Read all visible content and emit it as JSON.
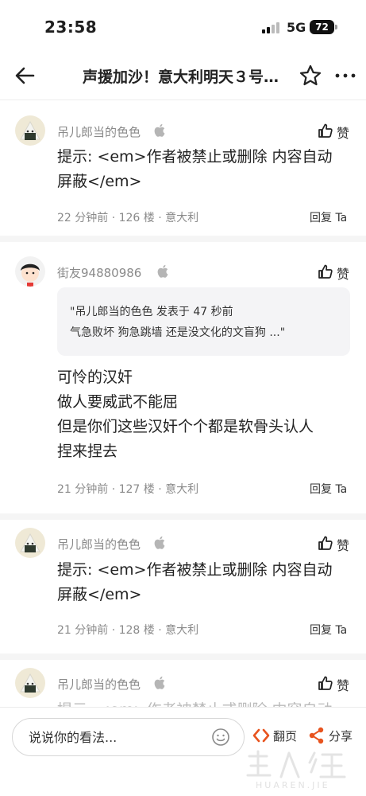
{
  "status_bar": {
    "time": "23:58",
    "network": "5G",
    "battery": "72"
  },
  "nav": {
    "title": "声援加沙！意大利明天３号…"
  },
  "comments": [
    {
      "user": "吊儿郎当的色色",
      "body": [
        "提示: <em>作者被禁止或删除 内容自动",
        "屏蔽</em>"
      ],
      "meta": "22 分钟前 · 126 楼 · 意大利",
      "like_label": "赞",
      "reply_label": "回复 Ta"
    },
    {
      "user": "街友94880986",
      "quote": [
        "\"吊儿郎当的色色 发表于 47 秒前",
        "气急败坏 狗急跳墙 还是没文化的文盲狗 ...\""
      ],
      "body": [
        "可怜的汉奸",
        "做人要威武不能屈",
        "但是你们这些汉奸个个都是软骨头认人",
        "捏来捏去"
      ],
      "meta": "21 分钟前 · 127 楼 · 意大利",
      "like_label": "赞",
      "reply_label": "回复 Ta"
    },
    {
      "user": "吊儿郎当的色色",
      "body": [
        "提示: <em>作者被禁止或删除 内容自动",
        "屏蔽</em>"
      ],
      "meta": "21 分钟前 · 128 楼 · 意大利",
      "like_label": "赞",
      "reply_label": "回复 Ta"
    },
    {
      "user": "吊儿郎当的色色",
      "body": [
        "提示: <em>作者被禁止或删除 内容自动"
      ],
      "like_label": "赞"
    }
  ],
  "bottom_bar": {
    "input_placeholder": "说说你的看法...",
    "page_label": "翻页",
    "share_label": "分享"
  },
  "watermark": {
    "text": "HUAREN.JIE"
  },
  "colors": {
    "accent": "#e8541f",
    "muted": "#8a8a8a"
  }
}
